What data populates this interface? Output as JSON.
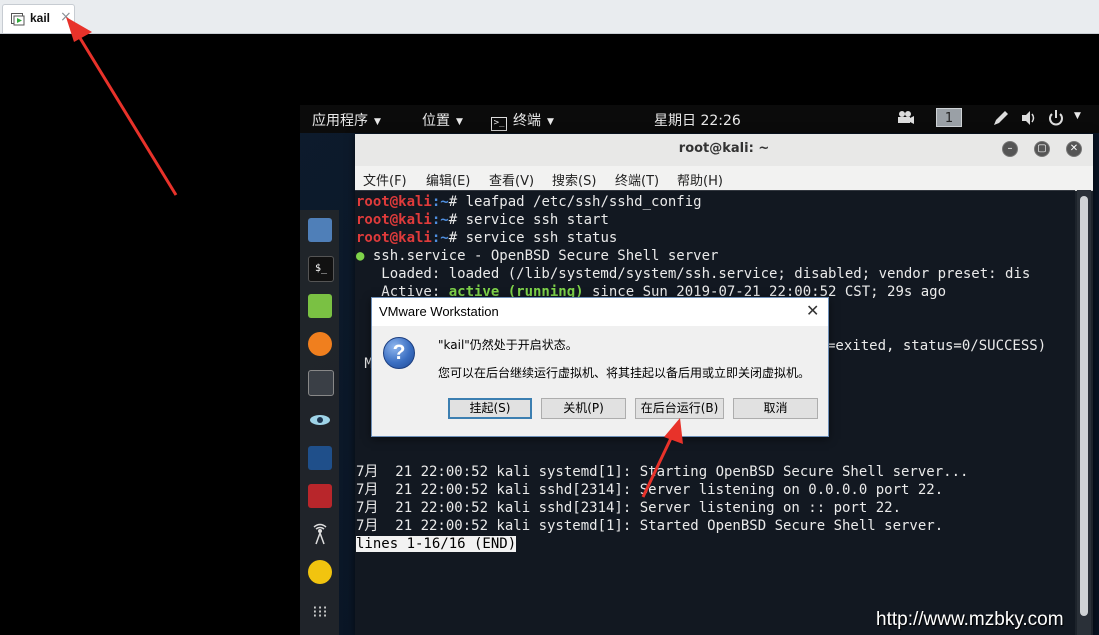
{
  "vmware_tab": {
    "label": "kail",
    "close": "×"
  },
  "topbar": {
    "apps_menu": "应用程序",
    "places_menu": "位置",
    "terminal_menu": "终端",
    "clock": "星期日 22:26",
    "workspace": "1"
  },
  "terminal": {
    "title": "root@kali: ~",
    "menu": [
      "文件(F)",
      "编辑(E)",
      "查看(V)",
      "搜索(S)",
      "终端(T)",
      "帮助(H)"
    ],
    "prompt_user": "root@kali",
    "prompt_path": ":~",
    "prompt_hash": "#",
    "commands": [
      "leafpad /etc/ssh/sshd_config",
      "service ssh start",
      "service ssh status"
    ],
    "status_dot": "●",
    "status_line": " ssh.service - OpenBSD Secure Shell server",
    "loaded_line": "   Loaded: loaded (/lib/systemd/system/ssh.service; disabled; vendor preset: dis",
    "active_prefix": "   Active: ",
    "active_state": "active (running)",
    "active_suffix": " since Sun 2019-07-21 22:00:52 CST; 29s ago",
    "exit_fragment": "=exited, status=0/SUCCESS)",
    "m_fragment": " M",
    "log_lines": [
      "7月  21 22:00:52 kali systemd[1]: Starting OpenBSD Secure Shell server...",
      "7月  21 22:00:52 kali sshd[2314]: Server listening on 0.0.0.0 port 22.",
      "7月  21 22:00:52 kali sshd[2314]: Server listening on :: port 22.",
      "7月  21 22:00:52 kali systemd[1]: Started OpenBSD Secure Shell server."
    ],
    "pager": "lines 1-16/16 (END)"
  },
  "dialog": {
    "title": "VMware Workstation",
    "close": "✕",
    "icon": "?",
    "message1": "\"kail\"仍然处于开启状态。",
    "message2": "您可以在后台继续运行虚拟机、将其挂起以备后用或立即关闭虚拟机。",
    "buttons": {
      "suspend": "挂起(S)",
      "power_off": "关机(P)",
      "background": "在后台运行(B)",
      "cancel": "取消"
    }
  },
  "watermark": "http://www.mzbky.com",
  "colors": {
    "prompt_red": "#e03b3b",
    "active_green": "#7ed34a",
    "arrow_red": "#e8322a"
  }
}
